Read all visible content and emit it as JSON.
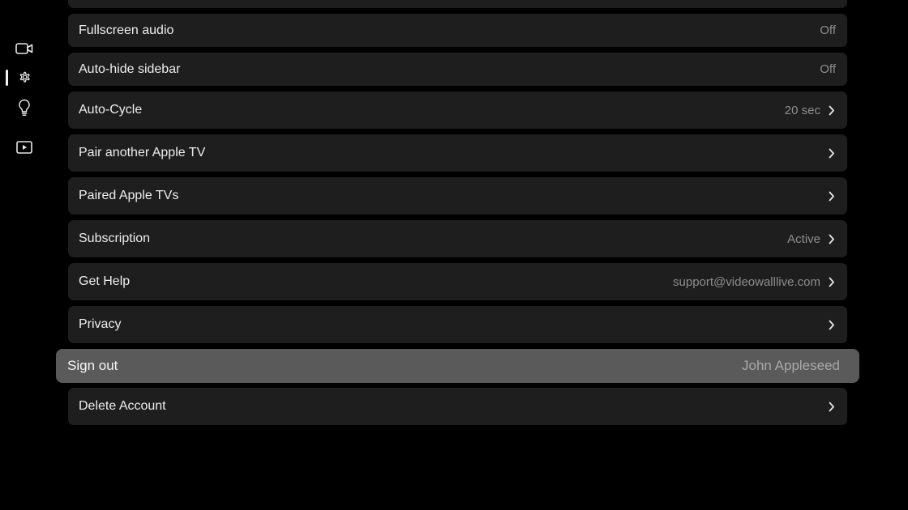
{
  "sidebar": {
    "items": [
      {
        "icon": "video-camera-icon",
        "selected": false
      },
      {
        "icon": "gear-icon",
        "selected": true
      },
      {
        "icon": "lightbulb-icon",
        "selected": false
      },
      {
        "icon": "play-icon",
        "selected": false
      }
    ]
  },
  "settings": {
    "rows": [
      {
        "label": "",
        "value": "",
        "chevron": false
      },
      {
        "label": "Fullscreen audio",
        "value": "Off",
        "chevron": false
      },
      {
        "label": "Auto-hide sidebar",
        "value": "Off",
        "chevron": false
      },
      {
        "label": "Auto-Cycle",
        "value": "20 sec",
        "chevron": true
      },
      {
        "label": "Pair another Apple TV",
        "value": "",
        "chevron": true
      },
      {
        "label": "Paired Apple TVs",
        "value": "",
        "chevron": true
      },
      {
        "label": "Subscription",
        "value": "Active",
        "chevron": true
      },
      {
        "label": "Get Help",
        "value": "support@videowalllive.com",
        "chevron": true
      },
      {
        "label": "Privacy",
        "value": "",
        "chevron": true
      },
      {
        "label": "Sign out",
        "value": "John Appleseed",
        "chevron": false,
        "focused": true
      },
      {
        "label": "Delete Account",
        "value": "",
        "chevron": true
      }
    ]
  },
  "colors": {
    "background": "#000000",
    "row_background": "#1e1e1e",
    "focused_row_background": "#5a5a5a",
    "label_text": "#ededed",
    "value_text": "#8e8e8e"
  }
}
